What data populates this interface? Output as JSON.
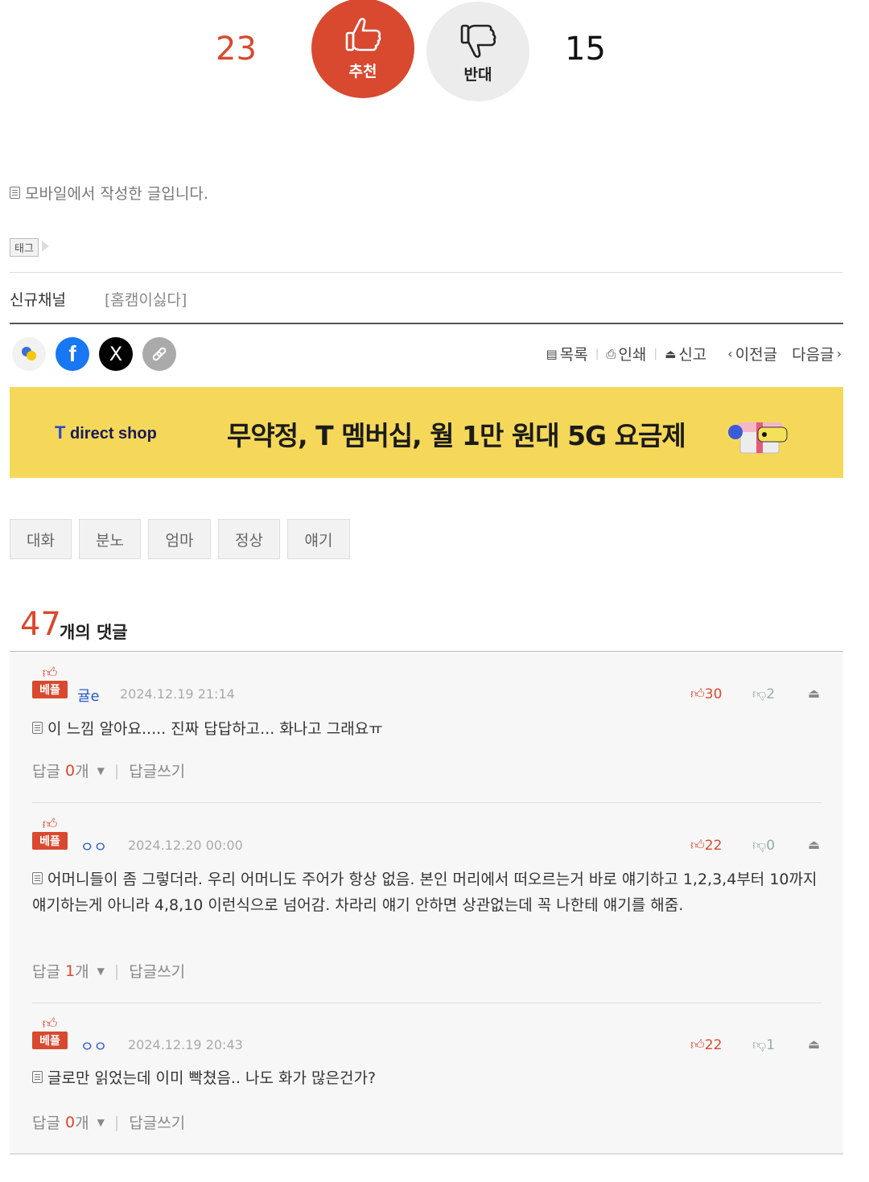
{
  "vote": {
    "up_count": "23",
    "up_label": "추천",
    "down_count": "15",
    "down_label": "반대"
  },
  "post": {
    "mobile_note": "모바일에서 작성한 글입니다.",
    "tag_label": "태그",
    "channel_label": "신규채널",
    "channel_name": "[홈캠이싫다]"
  },
  "share": {
    "icons": [
      "kakao-icon",
      "facebook-icon",
      "x-icon",
      "link-icon"
    ],
    "facebook_glyph": "f",
    "x_glyph": "X"
  },
  "toolbar": {
    "list": "목록",
    "print": "인쇄",
    "report": "신고",
    "prev": "이전글",
    "next": "다음글"
  },
  "banner": {
    "brand": "direct shop",
    "brand_mark": "T",
    "text": "무약정, T 멤버십, 월 1만 원대 5G 요금제",
    "bg_color": "#f5d85a"
  },
  "keywords": [
    "대화",
    "분노",
    "엄마",
    "정상",
    "얘기"
  ],
  "comments_header": {
    "count": "47",
    "label": "개의 댓글"
  },
  "comments": [
    {
      "badge": "베플",
      "nick": "귤e",
      "nick_color": "#2b57c9",
      "date": "2024.12.19 21:14",
      "likes": "30",
      "dislikes": "2",
      "text": "이 느낌 알아요..... 진짜 답답하고... 화나고 그래요ㅠ",
      "reply_label": "답글",
      "reply_count": "0",
      "reply_unit": "개",
      "write_reply": "답글쓰기"
    },
    {
      "badge": "베플",
      "nick": "ㅇㅇ",
      "nick_color": "#2b57c9",
      "date": "2024.12.20 00:00",
      "likes": "22",
      "dislikes": "0",
      "text": "어머니들이 좀 그렇더라. 우리 어머니도 주어가 항상 없음. 본인 머리에서 떠오르는거 바로 얘기하고 1,2,3,4부터 10까지 얘기하는게 아니라 4,8,10 이런식으로 넘어감. 차라리 얘기 안하면 상관없는데 꼭 나한테 얘기를 해줌.",
      "reply_label": "답글",
      "reply_count": "1",
      "reply_unit": "개",
      "write_reply": "답글쓰기"
    },
    {
      "badge": "베플",
      "nick": "ㅇㅇ",
      "nick_color": "#2b57c9",
      "date": "2024.12.19 20:43",
      "likes": "22",
      "dislikes": "1",
      "text": "글로만 읽었는데 이미 빡쳤음.. 나도 화가 많은건가?",
      "reply_label": "답글",
      "reply_count": "0",
      "reply_unit": "개",
      "write_reply": "답글쓰기"
    }
  ]
}
